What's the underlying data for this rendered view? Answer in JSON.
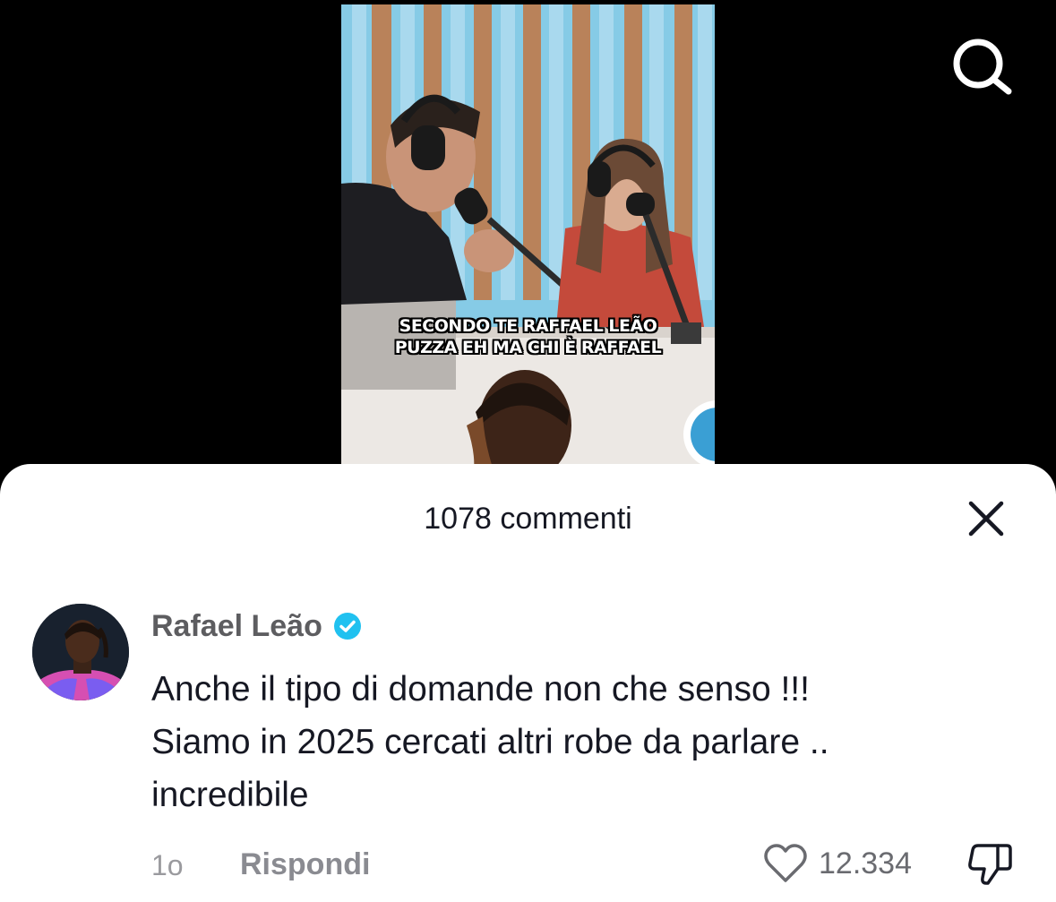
{
  "video": {
    "caption_line1": "SECONDO TE RAFFAEL LEÃO",
    "caption_line2": "PUZZA EH MA CHI È RAFFAEL"
  },
  "top_bar": {
    "search_icon": "search-icon"
  },
  "comments_sheet": {
    "title": "1078 commenti",
    "close_icon": "close-icon",
    "comment": {
      "author": "Rafael Leão",
      "verified_icon": "verified-badge-icon",
      "verified_color": "#20c1f0",
      "text_lines": [
        "Anche il tipo di domande non che senso !!!",
        "Siamo in 2025 cercati altri robe da parlare ..",
        "incredibile"
      ],
      "time": "1o",
      "reply_label": "Rispondi",
      "like_icon": "heart-outline-icon",
      "like_count": "12.334",
      "dislike_icon": "thumbs-down-icon"
    }
  },
  "colors": {
    "background": "#000000",
    "sheet": "#ffffff",
    "primary_text": "#161823",
    "secondary_text": "#8a8b91"
  }
}
